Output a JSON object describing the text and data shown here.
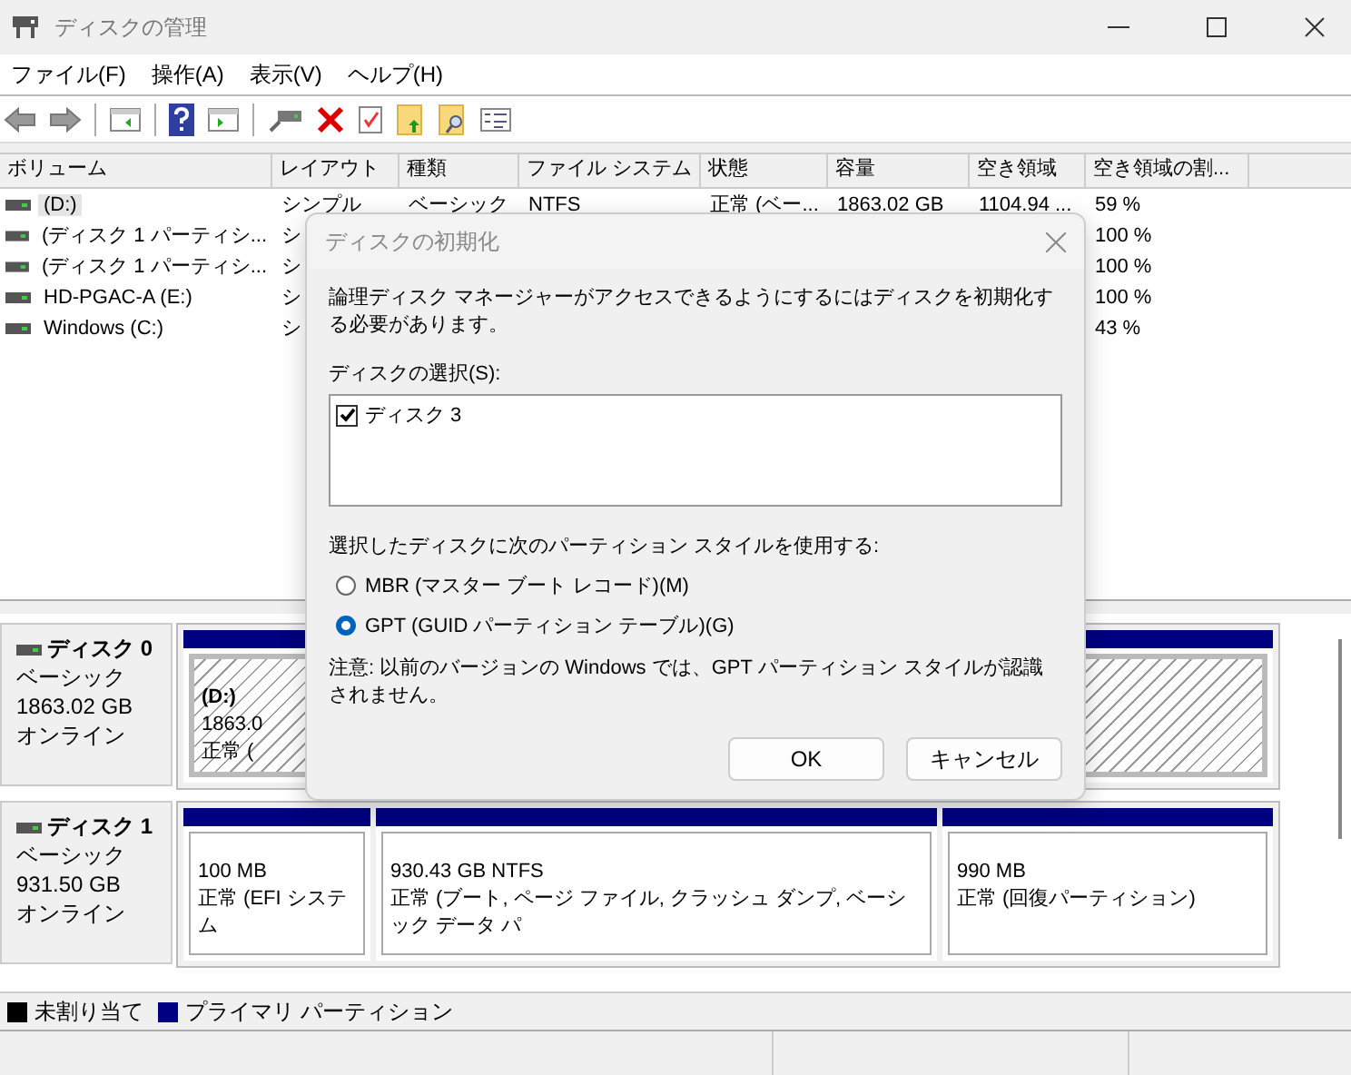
{
  "window": {
    "title": "ディスクの管理"
  },
  "menu": [
    "ファイル(F)",
    "操作(A)",
    "表示(V)",
    "ヘルプ(H)"
  ],
  "volume_table": {
    "columns": [
      "ボリューム",
      "レイアウト",
      "種類",
      "ファイル システム",
      "状態",
      "容量",
      "空き領域",
      "空き領域の割..."
    ],
    "rows": [
      {
        "volume": "(D:)",
        "layout": "シンプル",
        "type": "ベーシック",
        "file_system": "NTFS",
        "status": "正常 (ベー...",
        "capacity": "1863.02 GB",
        "free": "1104.94 ...",
        "percent_free": "59 %",
        "selected": true
      },
      {
        "volume": "(ディスク 1 パーティシ...",
        "layout": "シ",
        "percent_free": "100 %",
        "selected": false
      },
      {
        "volume": "(ディスク 1 パーティシ...",
        "layout": "シ",
        "percent_free": "100 %",
        "selected": false
      },
      {
        "volume": "HD-PGAC-A (E:)",
        "layout": "シ",
        "percent_free": "100 %",
        "selected": false
      },
      {
        "volume": "Windows (C:)",
        "layout": "シ",
        "percent_free": "43 %",
        "selected": false
      }
    ]
  },
  "disks": [
    {
      "name": "ディスク 0",
      "type": "ベーシック",
      "size": "1863.02 GB",
      "status": "オンライン",
      "partitions": [
        {
          "label": "(D:)",
          "lines": [
            "1863.0",
            "正常 ("
          ],
          "selected": true
        }
      ]
    },
    {
      "name": "ディスク 1",
      "type": "ベーシック",
      "size": "931.50 GB",
      "status": "オンライン",
      "partitions": [
        {
          "lines": [
            "100 MB",
            "正常 (EFI システム"
          ],
          "selected": false
        },
        {
          "lines": [
            "930.43 GB NTFS",
            "正常 (ブート, ページ ファイル, クラッシュ ダンプ, ベーシック データ パ"
          ],
          "selected": false
        },
        {
          "lines": [
            "990 MB",
            "正常 (回復パーティション)"
          ],
          "selected": false
        }
      ]
    }
  ],
  "legend": [
    {
      "label": "未割り当て",
      "color": "#000000"
    },
    {
      "label": "プライマリ パーティション",
      "color": "#000080"
    }
  ],
  "dialog": {
    "title": "ディスクの初期化",
    "message": "論理ディスク マネージャーがアクセスできるようにするにはディスクを初期化する必要があります。",
    "select_label": "ディスクの選択(S):",
    "disks": [
      {
        "label": "ディスク 3",
        "checked": true
      }
    ],
    "style_label": "選択したディスクに次のパーティション スタイルを使用する:",
    "options": [
      {
        "label": "MBR (マスター ブート レコード)(M)",
        "selected": false
      },
      {
        "label": "GPT (GUID パーティション テーブル)(G)",
        "selected": true
      }
    ],
    "note": "注意: 以前のバージョンの Windows では、GPT パーティション スタイルが認識されません。",
    "buttons": [
      "OK",
      "キャンセル"
    ]
  }
}
